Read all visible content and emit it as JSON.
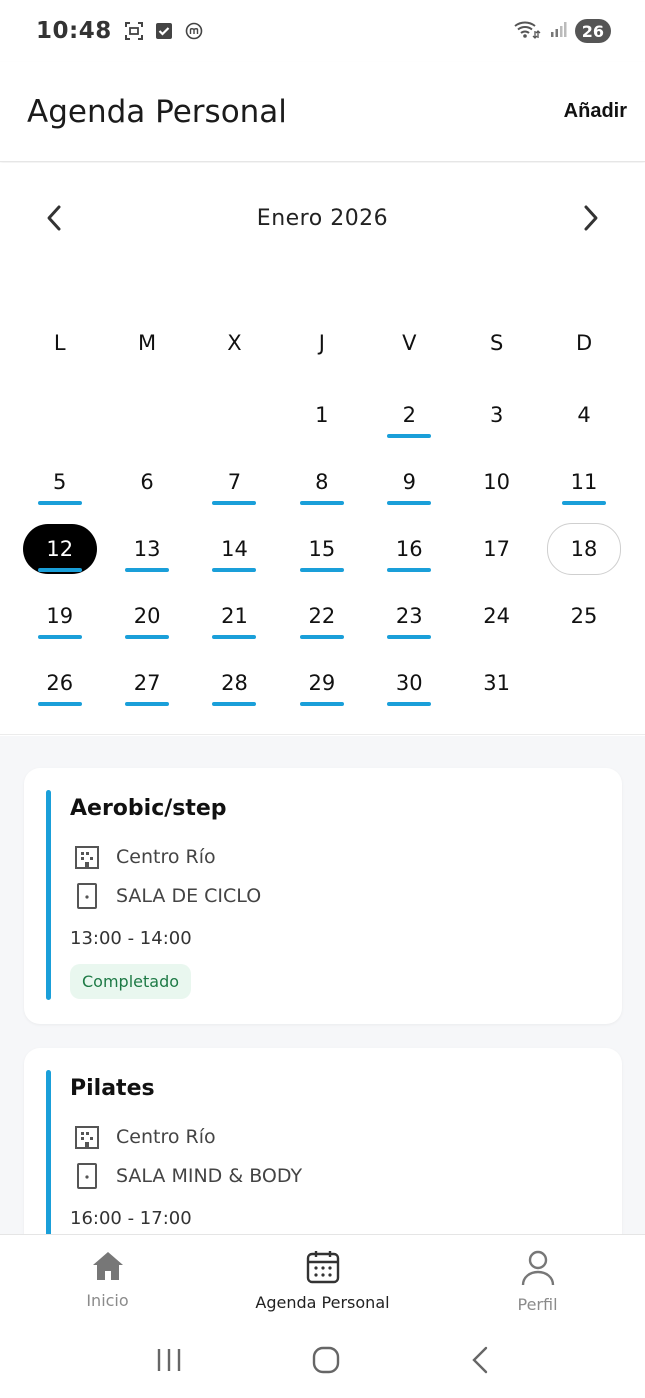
{
  "status_bar": {
    "time": "10:48",
    "battery": "26"
  },
  "header": {
    "title": "Agenda Personal",
    "add_label": "Añadir"
  },
  "calendar": {
    "month_label": "Enero 2026",
    "weekdays": [
      "L",
      "M",
      "X",
      "J",
      "V",
      "S",
      "D"
    ],
    "days": [
      {
        "n": "",
        "mark": false
      },
      {
        "n": "",
        "mark": false
      },
      {
        "n": "",
        "mark": false
      },
      {
        "n": "1",
        "mark": false
      },
      {
        "n": "2",
        "mark": true
      },
      {
        "n": "3",
        "mark": false
      },
      {
        "n": "4",
        "mark": false
      },
      {
        "n": "5",
        "mark": true
      },
      {
        "n": "6",
        "mark": false
      },
      {
        "n": "7",
        "mark": true
      },
      {
        "n": "8",
        "mark": true
      },
      {
        "n": "9",
        "mark": true
      },
      {
        "n": "10",
        "mark": false
      },
      {
        "n": "11",
        "mark": true
      },
      {
        "n": "12",
        "mark": true,
        "selected": true
      },
      {
        "n": "13",
        "mark": true
      },
      {
        "n": "14",
        "mark": true
      },
      {
        "n": "15",
        "mark": true
      },
      {
        "n": "16",
        "mark": true
      },
      {
        "n": "17",
        "mark": false
      },
      {
        "n": "18",
        "mark": false,
        "today": true
      },
      {
        "n": "19",
        "mark": true
      },
      {
        "n": "20",
        "mark": true
      },
      {
        "n": "21",
        "mark": true
      },
      {
        "n": "22",
        "mark": true
      },
      {
        "n": "23",
        "mark": true
      },
      {
        "n": "24",
        "mark": false
      },
      {
        "n": "25",
        "mark": false
      },
      {
        "n": "26",
        "mark": true
      },
      {
        "n": "27",
        "mark": true
      },
      {
        "n": "28",
        "mark": true
      },
      {
        "n": "29",
        "mark": true
      },
      {
        "n": "30",
        "mark": true
      },
      {
        "n": "31",
        "mark": false
      },
      {
        "n": "",
        "mark": false
      }
    ]
  },
  "events": [
    {
      "title": "Aerobic/step",
      "center": "Centro Río",
      "room": "SALA DE CICLO",
      "time": "13:00 - 14:00",
      "status": "Completado"
    },
    {
      "title": "Pilates",
      "center": "Centro Río",
      "room": "SALA MIND & BODY",
      "time": "16:00 - 17:00"
    }
  ],
  "bottom_nav": {
    "items": [
      {
        "label": "Inicio",
        "icon": "home-icon"
      },
      {
        "label": "Agenda Personal",
        "icon": "calendar-icon"
      },
      {
        "label": "Perfil",
        "icon": "person-icon"
      }
    ]
  },
  "colors": {
    "accent": "#1a9fd9",
    "selected": "#000000",
    "status_bg": "#e9f7ef",
    "status_text": "#1e7a46"
  }
}
